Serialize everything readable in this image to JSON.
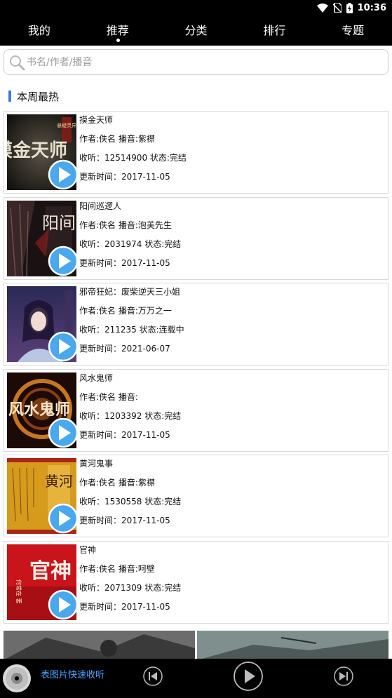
{
  "status_bar": {
    "time": "10:36",
    "icons": [
      "wifi-icon",
      "no-sim-icon",
      "battery-charging-icon"
    ]
  },
  "nav": {
    "tabs": [
      {
        "label": "我的"
      },
      {
        "label": "推荐",
        "active": true
      },
      {
        "label": "分类"
      },
      {
        "label": "排行"
      },
      {
        "label": "专题"
      }
    ]
  },
  "search": {
    "placeholder": "书名/作者/播音",
    "value": ""
  },
  "section": {
    "title": "本周最热",
    "accent_color": "#3d7be0"
  },
  "books": [
    {
      "title": "摸金天师",
      "author_line": "作者:佚名 播音:紫襟",
      "listens_line": "收听：12514900 状态:完结",
      "updated_line": "更新时间：2017-11-05",
      "cover_text": "摸金天师",
      "cover_badge": "悬疑灵异"
    },
    {
      "title": "阳间巡逻人",
      "author_line": "作者:佚名 播音:泡芙先生",
      "listens_line": "收听：2031974 状态:完结",
      "updated_line": "更新时间：2017-11-05",
      "cover_text": "阳间"
    },
    {
      "title": "邪帝狂妃：废柴逆天三小姐",
      "author_line": "作者:佚名 播音:万万之一",
      "listens_line": "收听：211235 状态:连载中",
      "updated_line": "更新时间：2021-06-07",
      "cover_text": ""
    },
    {
      "title": "风水鬼师",
      "author_line": "作者:佚名 播音:",
      "listens_line": "收听：1203392 状态:完结",
      "updated_line": "更新时间：2017-11-05",
      "cover_text": "风水鬼师"
    },
    {
      "title": "黄河鬼事",
      "author_line": "作者:佚名 播音:紫襟",
      "listens_line": "收听：1530558 状态:完结",
      "updated_line": "更新时间：2017-11-05",
      "cover_text": "黄河"
    },
    {
      "title": "官神",
      "author_line": "作者:佚名 播音:呵壁",
      "listens_line": "收听：2071309 状态:完结",
      "updated_line": "更新时间：2017-11-05",
      "cover_text": "官神",
      "cover_sub": "何常在 著"
    }
  ],
  "player": {
    "marquee_text": "表图片快速收听"
  }
}
